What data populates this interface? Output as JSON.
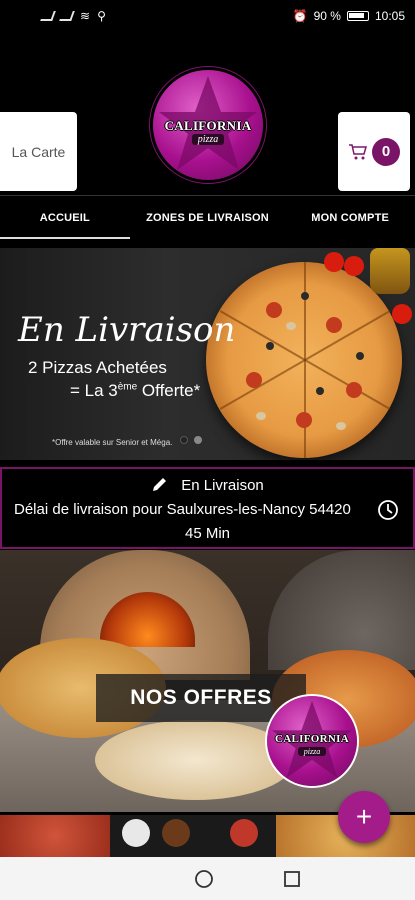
{
  "status_bar": {
    "battery_percent": "90 %",
    "time": "10:05"
  },
  "header": {
    "carte_label": "La Carte",
    "cart_count": "0",
    "logo_text": "CALIFORNIA",
    "logo_sub": "pizza"
  },
  "nav": {
    "tabs": [
      {
        "label": "ACCUEIL",
        "active": true
      },
      {
        "label": "ZONES DE LIVRAISON",
        "active": false
      },
      {
        "label": "MON COMPTE",
        "active": false
      }
    ]
  },
  "banner": {
    "title": "En Livraison",
    "line1": "2 Pizzas Achetées",
    "line2_prefix": "= La 3",
    "line2_sup": "ème",
    "line2_suffix": " Offerte*",
    "note": "*Offre valable sur Senior et Méga."
  },
  "delivery": {
    "mode": "En Livraison",
    "delay_text": "Délai de livraison pour Saulxures-les-Nancy 54420",
    "duration": "45 Min"
  },
  "offers": {
    "label": "NOS OFFRES",
    "logo_text": "CALIFORNIA",
    "logo_sub": "pizza"
  },
  "fab": {
    "label": "+"
  },
  "colors": {
    "brand": "#a31c8a",
    "border": "#7a1466"
  },
  "icons": [
    "pencil-icon",
    "clock-icon",
    "cart-icon",
    "plus-icon"
  ]
}
